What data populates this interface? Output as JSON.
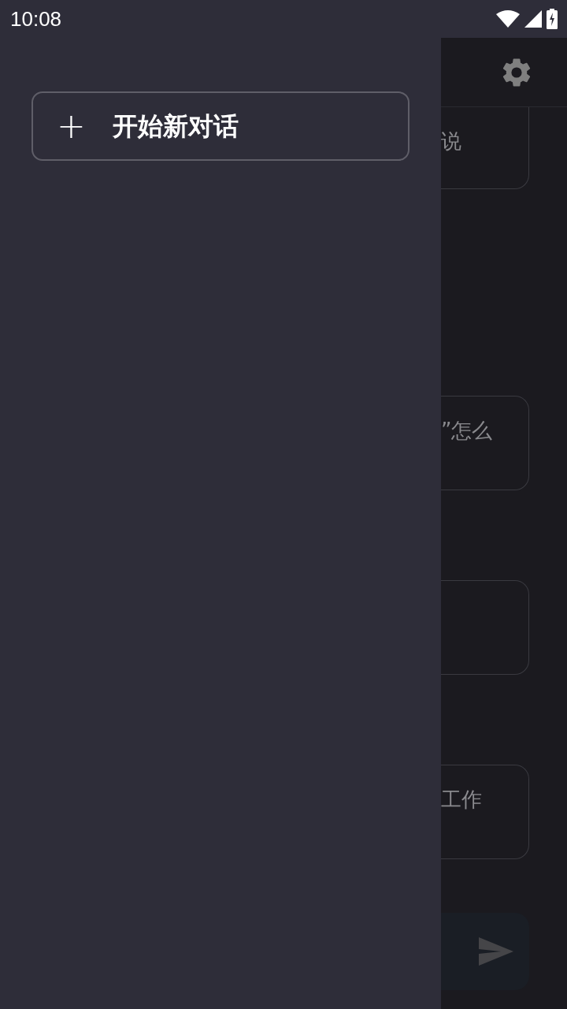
{
  "status_bar": {
    "time": "10:08"
  },
  "drawer": {
    "new_chat_button": {
      "icon": "+",
      "label": "开始新对话"
    }
  },
  "background": {
    "messages": [
      {
        "kind": "card",
        "text": "说"
      },
      {
        "kind": "card",
        "text": "”怎么"
      },
      {
        "kind": "card"
      },
      {
        "kind": "card",
        "text": "工作"
      }
    ]
  }
}
